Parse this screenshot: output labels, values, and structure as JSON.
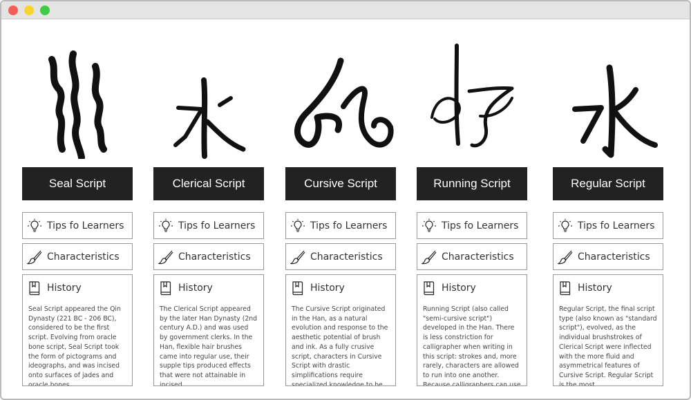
{
  "window": {
    "controls": [
      "close",
      "minimize",
      "zoom"
    ]
  },
  "labels": {
    "tips": "Tips fo Learners",
    "characteristics": "Characteristics",
    "history": "History"
  },
  "icons": {
    "tips": "lightbulb-icon",
    "characteristics": "brush-icon",
    "history": "bookmark-book-icon"
  },
  "columns": [
    {
      "glyph": "seal-script-character-image",
      "title": "Seal Script",
      "history_text": "Seal Script appeared the Qin Dynasty (221 BC - 206 BC), considered to be the first script. Evolving from oracle bone script, Seal Script took the form of pictograms and ideographs, and was incised onto surfaces of jades and oracle bones ......"
    },
    {
      "glyph": "clerical-script-character-image",
      "title": "Clerical Script",
      "history_text": "The Clerical Script appeared by the later Han Dynasty (2nd century A.D.) and was used by government clerks. In the Han, flexible hair brushes came into regular use, their supple tips produced effects that were not attainable in incised ......"
    },
    {
      "glyph": "cursive-script-character-image",
      "title": "Cursive Script",
      "history_text": "The Cursive Script originated in the Han, as a natural evolution and response to the aesthetic potential of brush and ink. As a fully crusive script, characters in Cursive Script with drastic simplifications require specialized knowledge to be recognized."
    },
    {
      "glyph": "running-script-character-image",
      "title": "Running Script",
      "history_text": "Running Script (also called \"semi-cursive script\") developed in the Han. There is less constriction for calligrapher when writing in this script: strokes and, more rarely, characters are allowed to run into one another. Because calligraphers can use brush ......"
    },
    {
      "glyph": "regular-script-character-image",
      "title": "Regular Script",
      "history_text": "Regular Script, the final script type (also known as \"standard script\"), evolved, as the individual brushstrokes of Clerical Script were inflected with the more fluid and asymmetrical features of Cursive Script. Regular Script is the most ......"
    }
  ]
}
